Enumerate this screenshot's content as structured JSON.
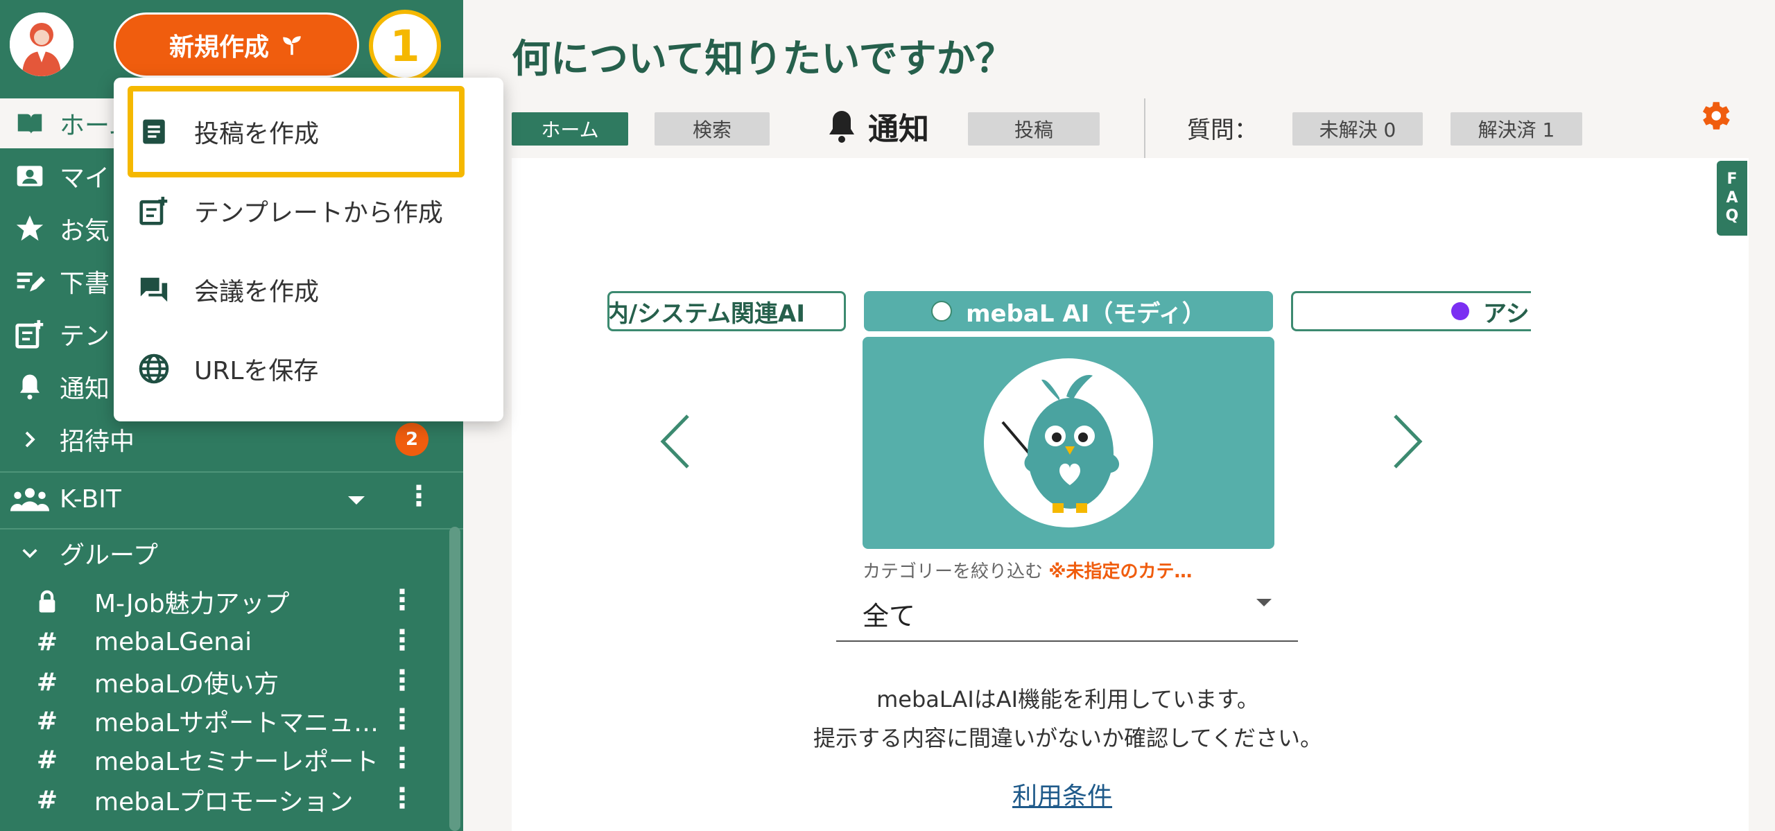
{
  "sidebar": {
    "new_button_label": "新規作成",
    "step_badge": "1",
    "nav": [
      {
        "label": "ホーム"
      },
      {
        "label": "マイ"
      },
      {
        "label": "お気"
      },
      {
        "label": "下書"
      },
      {
        "label": "テン"
      },
      {
        "label": "通知"
      },
      {
        "label": "招待中",
        "badge": "2"
      }
    ],
    "team": {
      "label": "K-BIT"
    },
    "groups_header": "グループ",
    "groups": [
      {
        "prefix": "🔒",
        "label": "M-Job魅力アップ"
      },
      {
        "prefix": "#",
        "label": "mebaLGenai"
      },
      {
        "prefix": "#",
        "label": "mebaLの使い方"
      },
      {
        "prefix": "#",
        "label": "mebaLサポートマニュ…"
      },
      {
        "prefix": "#",
        "label": "mebaLセミナーレポート"
      },
      {
        "prefix": "#",
        "label": "mebaLプロモーション"
      }
    ]
  },
  "menu": {
    "items": [
      {
        "label": "投稿を作成",
        "icon": "post-icon"
      },
      {
        "label": "テンプレートから作成",
        "icon": "template-icon"
      },
      {
        "label": "会議を作成",
        "icon": "meeting-icon"
      },
      {
        "label": "URLを保存",
        "icon": "globe-icon"
      }
    ]
  },
  "main": {
    "title": "何について知りたいですか？",
    "tabs": {
      "home": "ホーム",
      "search": "検索",
      "notification": "通知",
      "post": "投稿"
    },
    "question_label": "質問：",
    "unresolved": "未解決 0",
    "resolved": "解決済 1",
    "faq_letters": [
      "F",
      "A",
      "Q"
    ],
    "carousel": {
      "left_label": "内/システム関連AI",
      "center_label": "mebaL AI（モディ）",
      "right_label": "アシ",
      "right_dot_color": "#7b2ff2"
    },
    "category_caption": "カテゴリーを絞り込む",
    "category_warning": "※未指定のカテ…",
    "category_value": "全て",
    "notice_line1": "mebaLAIはAI機能を利用しています。",
    "notice_line2": "提示する内容に間違いがないか確認してください。",
    "terms_link": "利用条件"
  },
  "colors": {
    "sidebar_bg": "#2f7a60",
    "accent_orange": "#f05d0e",
    "highlight_yellow": "#f5b800",
    "teal": "#56afaa"
  }
}
